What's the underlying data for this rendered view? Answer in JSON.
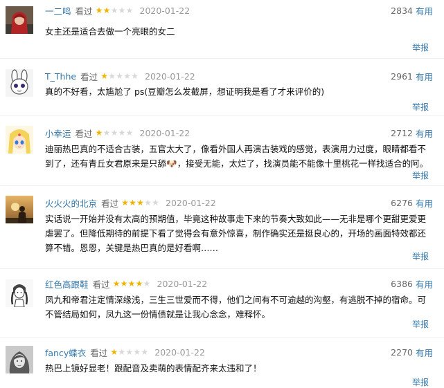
{
  "reviews": [
    {
      "user": "一二鸣",
      "watched_label": "看过",
      "rating": 2,
      "date": "2020-01-22",
      "votes": "2834",
      "useful_label": "有用",
      "content": "女主还是适合去做一个亮眼的女二",
      "report_label": "举报",
      "avatar": "avatar-red-hood-child"
    },
    {
      "user": "T_Thhe",
      "watched_label": "看过",
      "rating": 1,
      "date": "2020-01-22",
      "votes": "2961",
      "useful_label": "有用",
      "content": "真的不好看，太尴尬了 ps(豆瓣怎么发截屏，想证明我是看了才来评价的)",
      "report_label": "举报",
      "avatar": "avatar-cartoon-bunny"
    },
    {
      "user": "小幸运",
      "watched_label": "看过",
      "rating": 1,
      "date": "2020-01-22",
      "votes": "2712",
      "useful_label": "有用",
      "content": "迪丽热巴真的不适合古装，五官太大了，像看外国人再演古装戏的感觉，表演用力过度，眼睛都看不到了，还有青丘女君原来是只舔🐶，接受无能，太烂了，找演员能不能像十里桃花一样找适合的阿。",
      "report_label": "举报",
      "avatar": "avatar-sailor-moon"
    },
    {
      "user": "火火火的北京",
      "watched_label": "看过",
      "rating": 3,
      "date": "2020-01-22",
      "votes": "6276",
      "useful_label": "有用",
      "content": "实话说一开始并没有太高的预期值，毕竟这种故事走下来的节奏大致如此——无非是哪个更甜更爱更虐罢了。但降低期待的前提下看了觉得会有意外惊喜，制作确实还是挺良心的，开场的画面特效都还算不错。恩恩，关键是热巴真的是好看啊……",
      "report_label": "举报",
      "avatar": "avatar-sunset-silhouette"
    },
    {
      "user": "红色高跟鞋",
      "watched_label": "看过",
      "rating": 4,
      "date": "2020-01-22",
      "votes": "6386",
      "useful_label": "有用",
      "content": "凤九和帝君注定情深缘浅，三生三世爱而不得，他们之间有不可逾越的沟壑，有逃脱不掉的宿命。可不管结局如何，凤九这一份情债就是让我心念念，难释怀。",
      "report_label": "举报",
      "avatar": "avatar-braided-girl-sketch"
    },
    {
      "user": "fancy蝶衣",
      "watched_label": "看过",
      "rating": 1,
      "date": "2020-01-22",
      "votes": "2270",
      "useful_label": "有用",
      "content": "热巴上镜好显老！跟配音及卖萌的表情配齐来太违和了！",
      "report_label": "举报",
      "avatar": "avatar-bw-woman-portrait"
    }
  ],
  "colors": {
    "link": "#3377aa",
    "star_on": "#f0b400",
    "star_off": "#d8d8d8",
    "date": "#999999"
  }
}
